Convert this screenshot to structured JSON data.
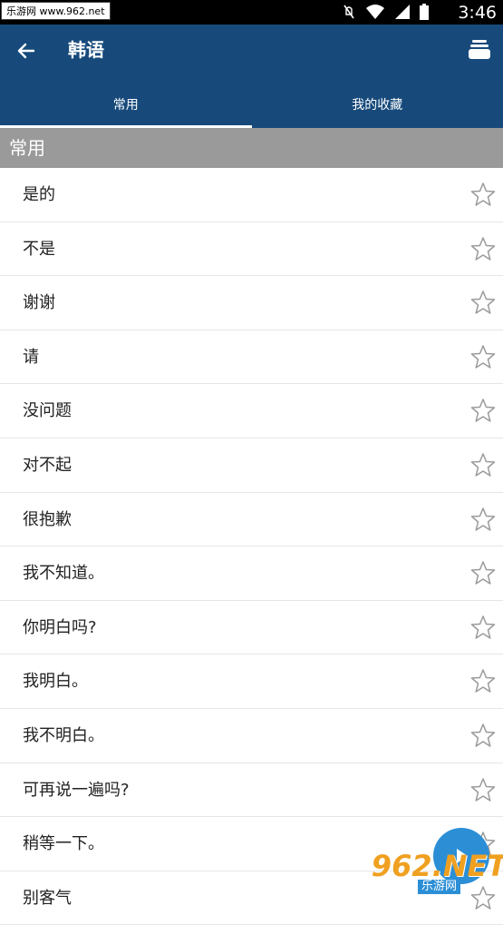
{
  "status_bar": {
    "watermark": "乐游网 www.962.net",
    "time": "3:46"
  },
  "app_bar": {
    "title": "韩语",
    "back_icon": "arrow-left-icon",
    "menu_icon": "layers-icon"
  },
  "tabs": [
    {
      "label": "常用",
      "active": true
    },
    {
      "label": "我的收藏",
      "active": false
    }
  ],
  "section": {
    "title": "常用"
  },
  "phrases": [
    {
      "text": "是的"
    },
    {
      "text": "不是"
    },
    {
      "text": "谢谢"
    },
    {
      "text": "请"
    },
    {
      "text": "没问题"
    },
    {
      "text": "对不起"
    },
    {
      "text": "很抱歉"
    },
    {
      "text": "我不知道。"
    },
    {
      "text": "你明白吗?"
    },
    {
      "text": "我明白。"
    },
    {
      "text": "我不明白。"
    },
    {
      "text": "可再说一遍吗?"
    },
    {
      "text": "稍等一下。"
    },
    {
      "text": "别客气"
    }
  ],
  "watermark_logo": {
    "main": "962.NET",
    "sub": "乐游网"
  },
  "colors": {
    "app_bar": "#174a7b",
    "section_header": "#9a9a9a",
    "fab": "#2c8fd6"
  }
}
